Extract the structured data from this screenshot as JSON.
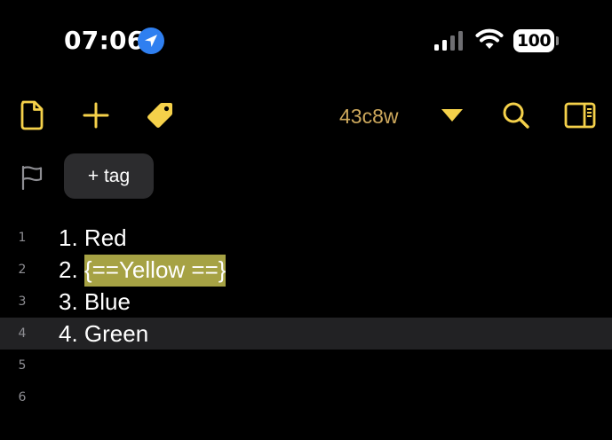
{
  "status_bar": {
    "time": "07:06",
    "battery": "100",
    "icons": [
      "location-arrow-icon",
      "cellular-signal-icon",
      "wifi-icon",
      "battery-icon"
    ]
  },
  "toolbar": {
    "icons": [
      "document-icon",
      "plus-icon",
      "tag-icon",
      "caret-down-icon",
      "search-icon",
      "sidebar-icon"
    ],
    "note_title": "43c8w",
    "accent_color": "#f5d14a"
  },
  "tag_row": {
    "flag_icon": "flag-icon",
    "add_tag_label": "+ tag"
  },
  "editor": {
    "current_line": 4,
    "lines": [
      {
        "number": "1",
        "prefix": "1. ",
        "text": "Red",
        "highlighted": ""
      },
      {
        "number": "2",
        "prefix": "2. ",
        "text": "",
        "highlighted": "{==Yellow ==}"
      },
      {
        "number": "3",
        "prefix": "3. ",
        "text": "Blue",
        "highlighted": ""
      },
      {
        "number": "4",
        "prefix": "4. ",
        "text": "Green",
        "highlighted": ""
      },
      {
        "number": "5",
        "prefix": "",
        "text": "",
        "highlighted": ""
      },
      {
        "number": "6",
        "prefix": "",
        "text": "",
        "highlighted": ""
      }
    ],
    "highlight_color": "#a6a244"
  }
}
